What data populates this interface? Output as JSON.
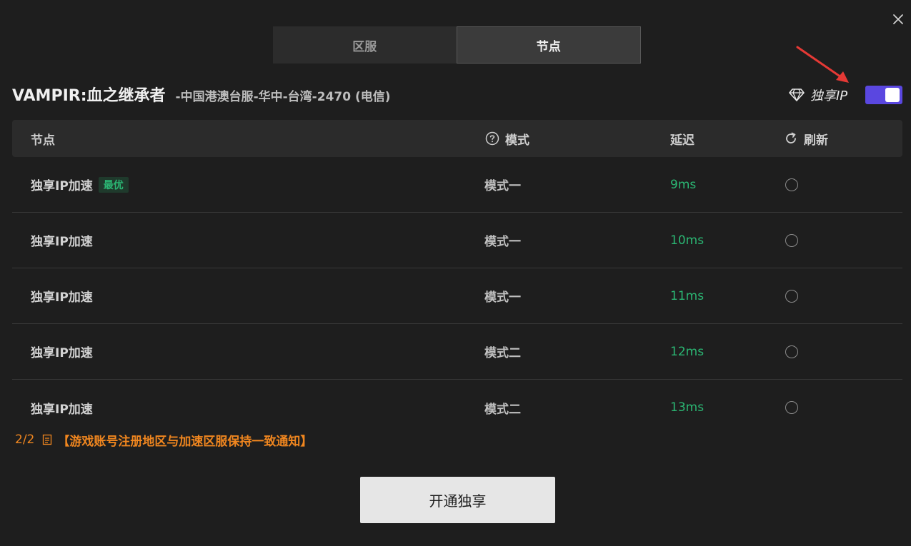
{
  "tabs": [
    {
      "label": "区服",
      "active": false
    },
    {
      "label": "节点",
      "active": true
    }
  ],
  "game": {
    "name": "VAMPIR:血之继承者",
    "server": "-中国港澳台服-华中-台湾-2470 (电信)"
  },
  "exclusive_ip": {
    "label": "独享IP",
    "enabled": true,
    "accent_color": "#5a47e0"
  },
  "table": {
    "headers": {
      "node": "节点",
      "mode": "模式",
      "latency": "延迟",
      "refresh": "刷新"
    },
    "rows": [
      {
        "node": "独享IP加速",
        "badge": "最优",
        "mode": "模式一",
        "latency": "9ms",
        "selected": false
      },
      {
        "node": "独享IP加速",
        "badge": "",
        "mode": "模式一",
        "latency": "10ms",
        "selected": false
      },
      {
        "node": "独享IP加速",
        "badge": "",
        "mode": "模式一",
        "latency": "11ms",
        "selected": false
      },
      {
        "node": "独享IP加速",
        "badge": "",
        "mode": "模式二",
        "latency": "12ms",
        "selected": false
      },
      {
        "node": "独享IP加速",
        "badge": "",
        "mode": "模式二",
        "latency": "13ms",
        "selected": false
      }
    ],
    "latency_color": "#2bb673"
  },
  "notice": {
    "page": "2/2",
    "text": "【游戏账号注册地区与加速区服保持一致通知】",
    "color": "#f0861f"
  },
  "primary_button": {
    "label": "开通独享"
  },
  "icons": {
    "close": "close-icon",
    "diamond": "diamond-icon",
    "help": "question-circle-icon",
    "refresh": "refresh-icon",
    "document": "document-icon",
    "arrow": "red-arrow-icon"
  }
}
